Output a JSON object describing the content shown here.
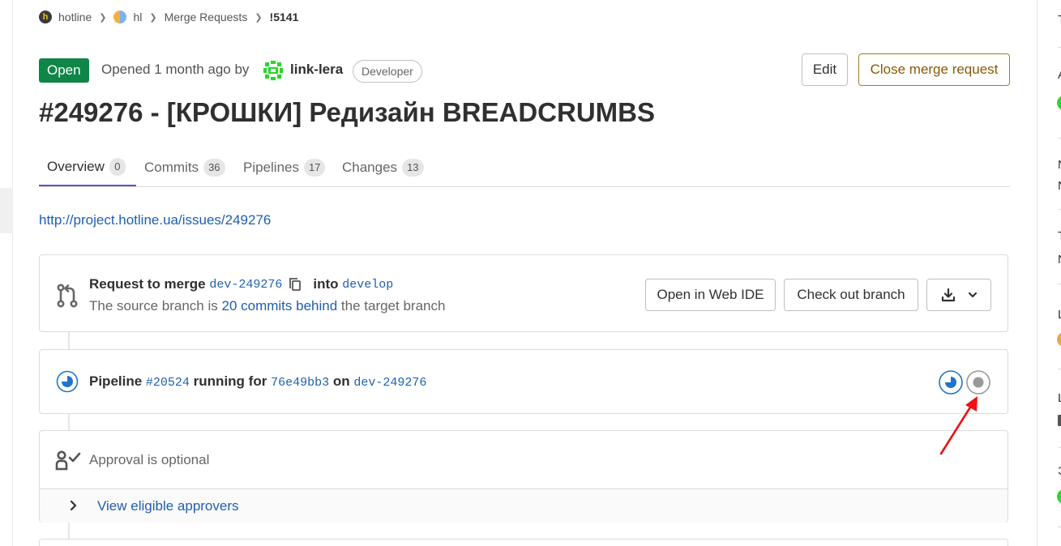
{
  "breadcrumb": {
    "group": "hotline",
    "group_avatar_letter": "h",
    "project": "hl",
    "section": "Merge Requests",
    "current": "!5141"
  },
  "header": {
    "status": "Open",
    "opened_prefix": "Opened 1 month ago by",
    "author": "link-lera",
    "author_role": "Developer",
    "edit_label": "Edit",
    "close_label": "Close merge request"
  },
  "title": "#249276 - [КРОШКИ] Редизайн BREADCRUMBS",
  "tabs": [
    {
      "label": "Overview",
      "count": "0"
    },
    {
      "label": "Commits",
      "count": "36"
    },
    {
      "label": "Pipelines",
      "count": "17"
    },
    {
      "label": "Changes",
      "count": "13"
    }
  ],
  "description_link": "http://project.hotline.ua/issues/249276",
  "merge_widget": {
    "request_label": "Request to merge",
    "source_branch": "dev-249276",
    "into_label": "into",
    "target_branch": "develop",
    "behind_prefix": "The source branch is",
    "behind_link": "20 commits behind",
    "behind_suffix": "the target branch",
    "web_ide_label": "Open in Web IDE",
    "checkout_label": "Check out branch"
  },
  "pipeline": {
    "label": "Pipeline",
    "id": "#20524",
    "running_label": "running for",
    "commit": "76e49bb3",
    "on_label": "on",
    "branch": "dev-249276"
  },
  "approval": {
    "text": "Approval is optional",
    "view_approvers": "View eligible approvers"
  },
  "right_sidebar": {
    "letters": [
      "T",
      "A",
      "N",
      "N",
      "T",
      "N",
      "L",
      "L",
      "Э"
    ]
  },
  "colors": {
    "open_badge": "#108548",
    "link": "#1f5fb0",
    "tab_active_border": "#6e49cb",
    "running": "#1f75cb",
    "annotation_arrow": "#ee1111"
  }
}
